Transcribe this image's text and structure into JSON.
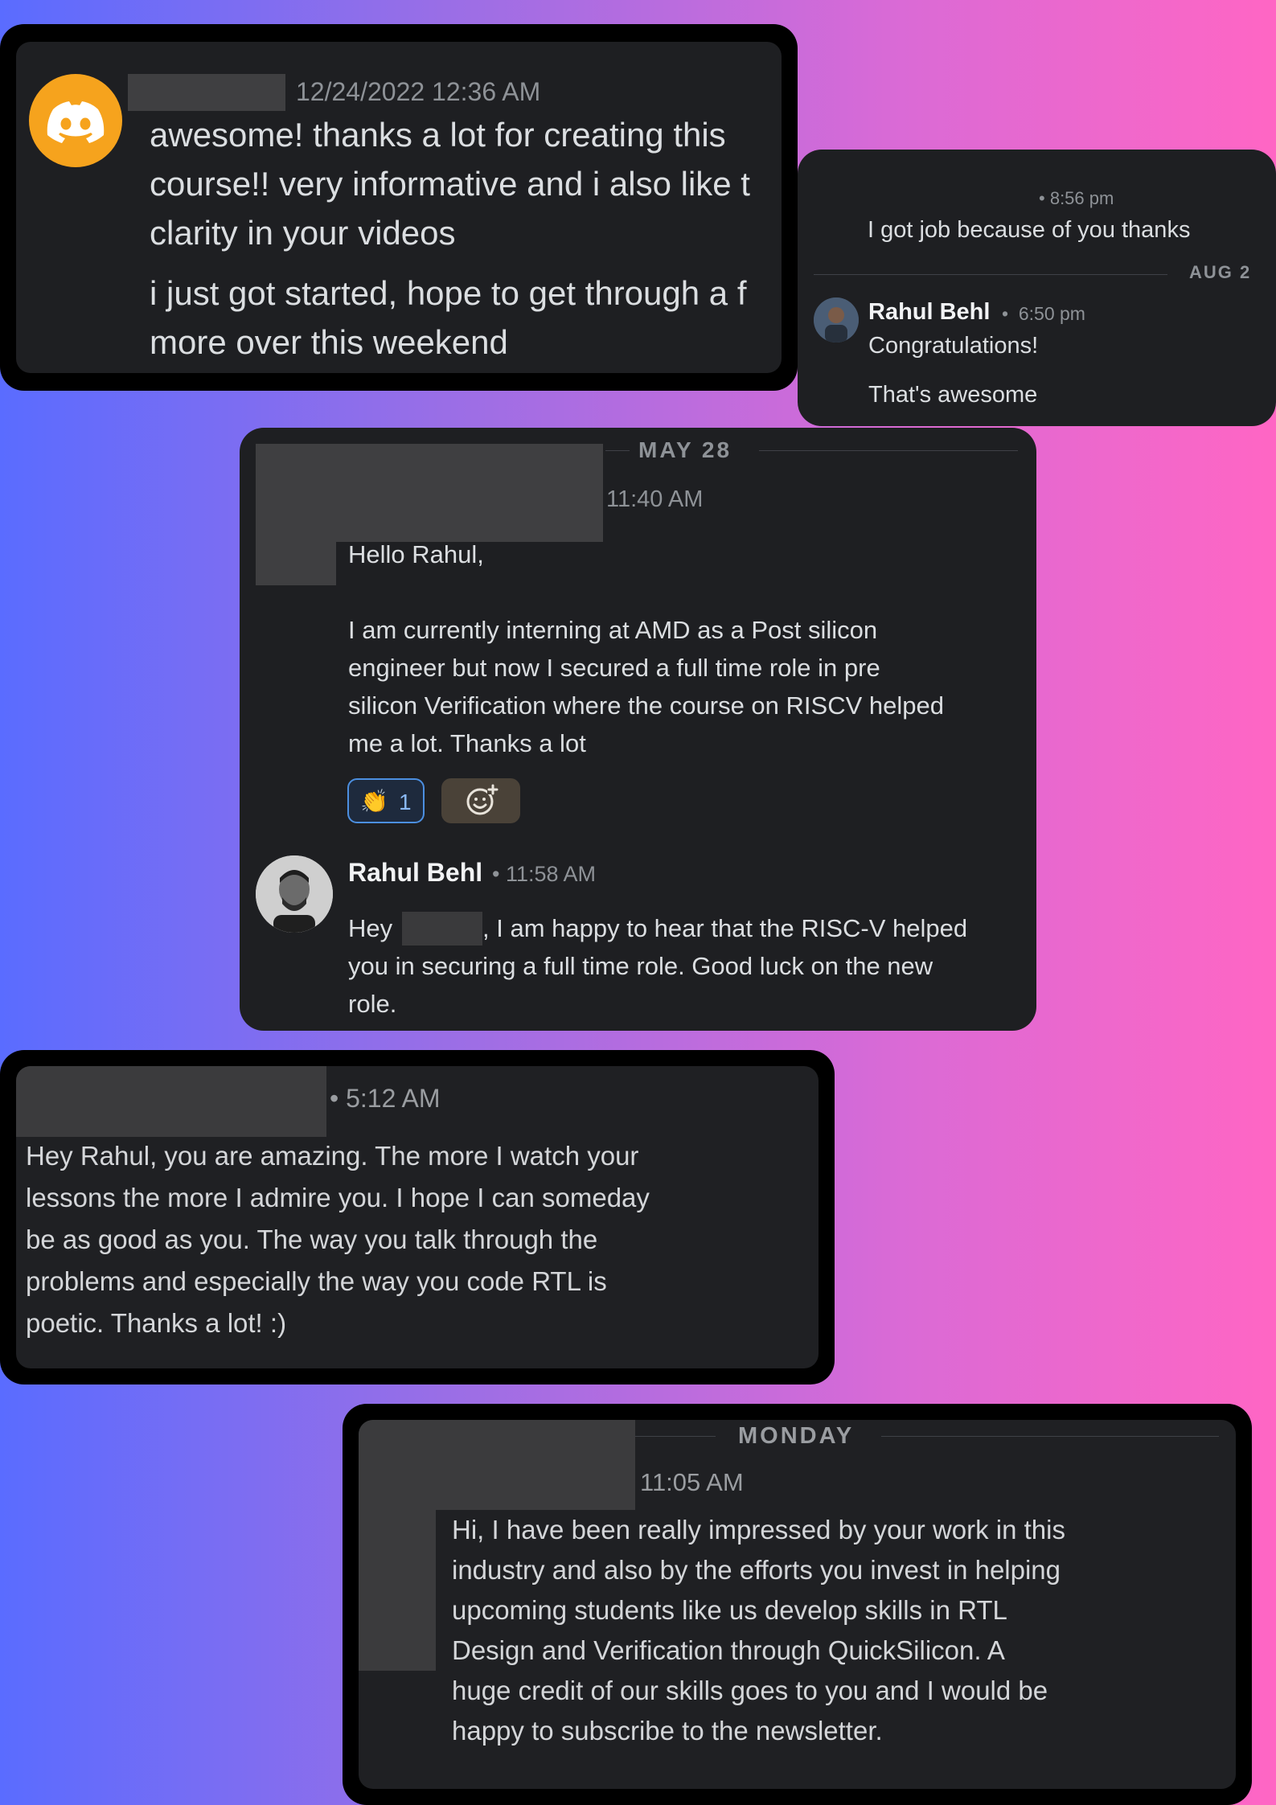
{
  "cards": {
    "c1": {
      "timestamp": "12/24/2022 12:36 AM",
      "lines": [
        "awesome! thanks a lot for creating this",
        "course!! very informative and i also like t",
        "clarity in your videos",
        "i just got started, hope to get through a f",
        "more over this weekend"
      ],
      "avatar_icon": "discord-logo-icon",
      "avatar_color": "#f6a31d"
    },
    "c2": {
      "time": "8:56 pm",
      "message": "I got job because of you thanks",
      "date_divider": "AUG 2",
      "reply_author": "Rahul Behl",
      "reply_time": "6:50 pm",
      "reply_lines": [
        "Congratulations!",
        "That's awesome"
      ]
    },
    "c3": {
      "date_divider": "MAY 28",
      "time": "11:40 AM",
      "greeting": "Hello Rahul,",
      "lines": [
        "I am currently interning at AMD as a Post silicon",
        "engineer but now I secured a full time role in pre",
        "silicon Verification where the course on RISCV helped",
        "me a lot. Thanks a lot"
      ],
      "reaction_emoji": "👏",
      "reaction_count": "1",
      "add_reaction_icon": "add-reaction-icon",
      "reply_author": "Rahul Behl",
      "reply_time": "11:58 AM",
      "reply_prefix": "Hey",
      "reply_line1_rest": ", I am happy to hear that the RISC-V helped",
      "reply_line2": "you in securing a full time role. Good luck on the new",
      "reply_line3": "role.",
      "reaction_color": "#4c8fe0"
    },
    "c4": {
      "time": "5:12 AM",
      "lines": [
        "Hey Rahul, you are amazing. The more I watch your",
        "lessons the more I admire you. I hope I can someday",
        "be as good as you. The way you talk through the",
        "problems and especially the way you code RTL is",
        "poetic. Thanks a lot! :)"
      ]
    },
    "c5": {
      "date_divider": "MONDAY",
      "time": "11:05 AM",
      "lines": [
        "Hi, I have been really impressed by your work in this",
        "industry and also by the efforts you invest in helping",
        "upcoming students like us develop skills in RTL",
        "Design and Verification through QuickSilicon. A",
        "huge credit of our skills goes to you and I would be",
        "happy to subscribe to the newsletter."
      ]
    }
  },
  "colors": {
    "card_bg": "#1e1f22",
    "text": "#dbdee1",
    "muted": "#8e9297",
    "redaction": "#3f3f41"
  }
}
